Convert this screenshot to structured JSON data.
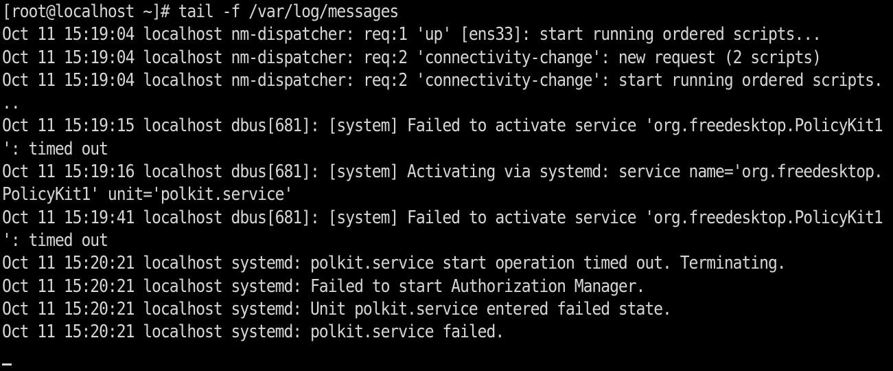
{
  "terminal": {
    "lines": [
      "[root@localhost ~]# tail -f /var/log/messages",
      "Oct 11 15:19:04 localhost nm-dispatcher: req:1 'up' [ens33]: start running ordered scripts...",
      "Oct 11 15:19:04 localhost nm-dispatcher: req:2 'connectivity-change': new request (2 scripts)",
      "Oct 11 15:19:04 localhost nm-dispatcher: req:2 'connectivity-change': start running ordered scripts.",
      "..",
      "Oct 11 15:19:15 localhost dbus[681]: [system] Failed to activate service 'org.freedesktop.PolicyKit1",
      "': timed out",
      "Oct 11 15:19:16 localhost dbus[681]: [system] Activating via systemd: service name='org.freedesktop.",
      "PolicyKit1' unit='polkit.service'",
      "Oct 11 15:19:41 localhost dbus[681]: [system] Failed to activate service 'org.freedesktop.PolicyKit1",
      "': timed out",
      "Oct 11 15:20:21 localhost systemd: polkit.service start operation timed out. Terminating.",
      "Oct 11 15:20:21 localhost systemd: Failed to start Authorization Manager.",
      "Oct 11 15:20:21 localhost systemd: Unit polkit.service entered failed state.",
      "Oct 11 15:20:21 localhost systemd: polkit.service failed."
    ],
    "colors": {
      "background": "#000000",
      "foreground": "#d6d6d6"
    }
  }
}
